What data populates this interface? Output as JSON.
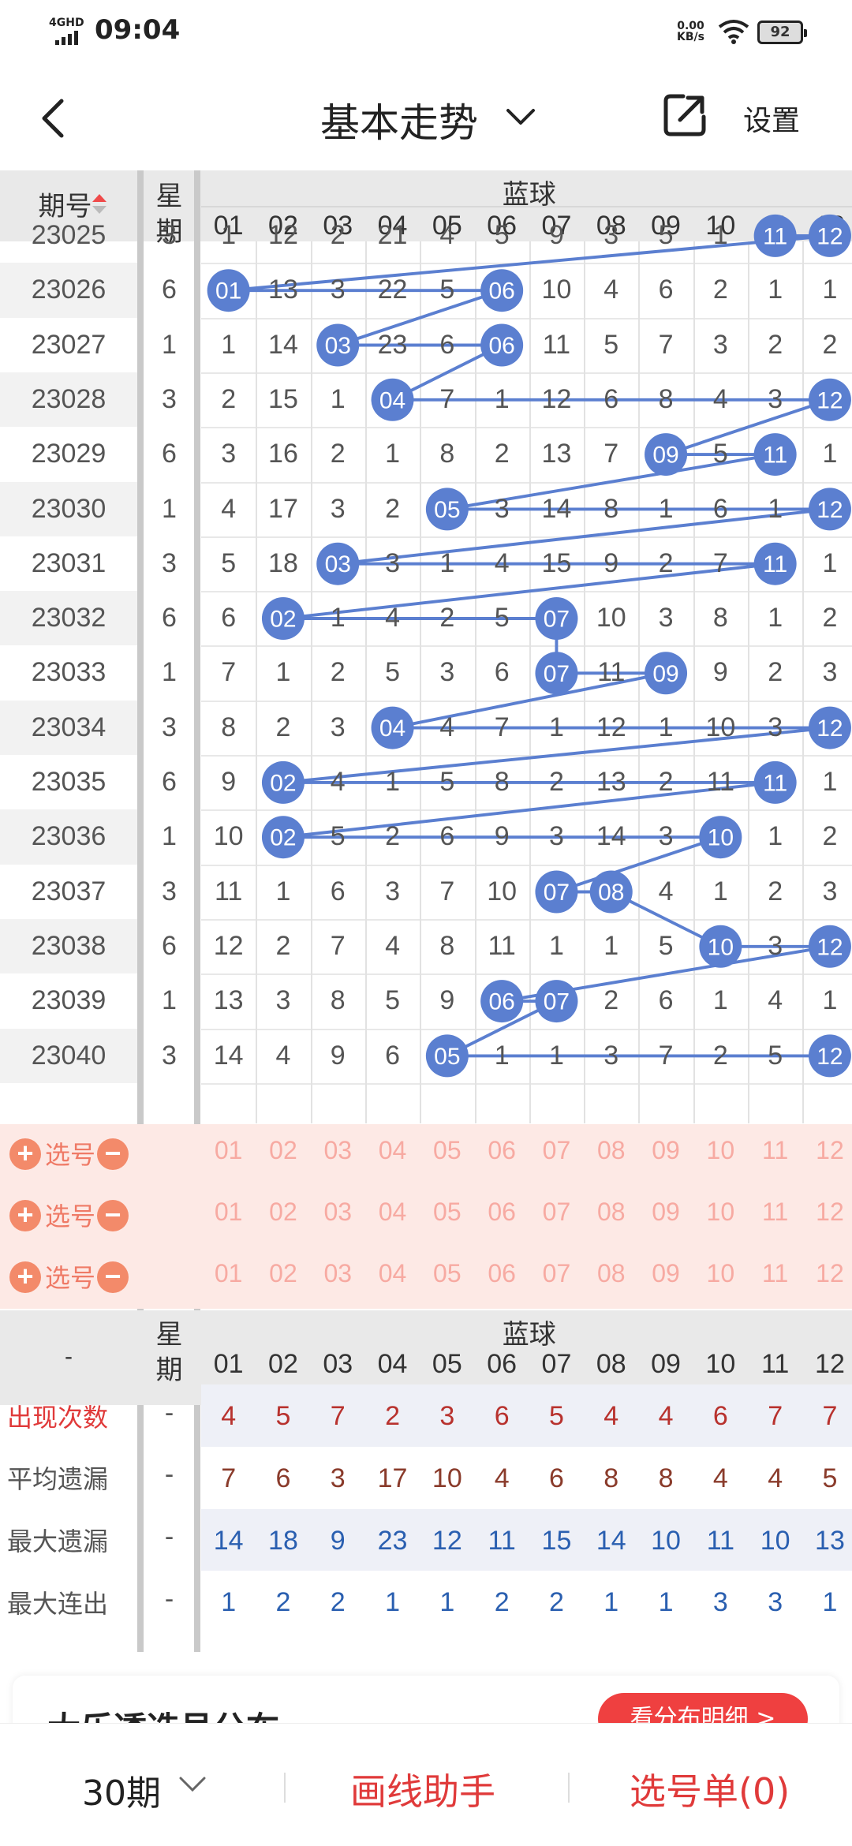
{
  "status_bar": {
    "network": "4GHD",
    "time": "09:04",
    "speed_value": "0.00",
    "speed_unit": "KB/s",
    "battery": "92"
  },
  "header": {
    "title": "基本走势",
    "settings": "设置"
  },
  "table": {
    "period_header": "期号",
    "week_header_1": "星",
    "week_header_2": "期",
    "section_header": "蓝球",
    "columns": [
      "01",
      "02",
      "03",
      "04",
      "05",
      "06",
      "07",
      "08",
      "09",
      "10",
      "11",
      "12"
    ],
    "rows": [
      {
        "period": "23025",
        "week": "3",
        "cells": [
          "1",
          "12",
          "2",
          "21",
          "4",
          "5",
          "9",
          "3",
          "5",
          "1",
          "11",
          "12"
        ]
      },
      {
        "period": "23026",
        "week": "6",
        "cells": [
          "01",
          "13",
          "3",
          "22",
          "5",
          "06",
          "10",
          "4",
          "6",
          "2",
          "1",
          "1"
        ]
      },
      {
        "period": "23027",
        "week": "1",
        "cells": [
          "1",
          "14",
          "03",
          "23",
          "6",
          "06",
          "11",
          "5",
          "7",
          "3",
          "2",
          "2"
        ]
      },
      {
        "period": "23028",
        "week": "3",
        "cells": [
          "2",
          "15",
          "1",
          "04",
          "7",
          "1",
          "12",
          "6",
          "8",
          "4",
          "3",
          "12"
        ]
      },
      {
        "period": "23029",
        "week": "6",
        "cells": [
          "3",
          "16",
          "2",
          "1",
          "8",
          "2",
          "13",
          "7",
          "09",
          "5",
          "11",
          "1"
        ]
      },
      {
        "period": "23030",
        "week": "1",
        "cells": [
          "4",
          "17",
          "3",
          "2",
          "05",
          "3",
          "14",
          "8",
          "1",
          "6",
          "1",
          "12"
        ]
      },
      {
        "period": "23031",
        "week": "3",
        "cells": [
          "5",
          "18",
          "03",
          "3",
          "1",
          "4",
          "15",
          "9",
          "2",
          "7",
          "11",
          "1"
        ]
      },
      {
        "period": "23032",
        "week": "6",
        "cells": [
          "6",
          "02",
          "1",
          "4",
          "2",
          "5",
          "07",
          "10",
          "3",
          "8",
          "1",
          "2"
        ]
      },
      {
        "period": "23033",
        "week": "1",
        "cells": [
          "7",
          "1",
          "2",
          "5",
          "3",
          "6",
          "07",
          "11",
          "09",
          "9",
          "2",
          "3"
        ]
      },
      {
        "period": "23034",
        "week": "3",
        "cells": [
          "8",
          "2",
          "3",
          "04",
          "4",
          "7",
          "1",
          "12",
          "1",
          "10",
          "3",
          "12"
        ]
      },
      {
        "period": "23035",
        "week": "6",
        "cells": [
          "9",
          "02",
          "4",
          "1",
          "5",
          "8",
          "2",
          "13",
          "2",
          "11",
          "11",
          "1"
        ]
      },
      {
        "period": "23036",
        "week": "1",
        "cells": [
          "10",
          "02",
          "5",
          "2",
          "6",
          "9",
          "3",
          "14",
          "3",
          "10",
          "1",
          "2"
        ]
      },
      {
        "period": "23037",
        "week": "3",
        "cells": [
          "11",
          "1",
          "6",
          "3",
          "7",
          "10",
          "07",
          "08",
          "4",
          "1",
          "2",
          "3"
        ]
      },
      {
        "period": "23038",
        "week": "6",
        "cells": [
          "12",
          "2",
          "7",
          "4",
          "8",
          "11",
          "1",
          "1",
          "5",
          "10",
          "3",
          "12"
        ]
      },
      {
        "period": "23039",
        "week": "1",
        "cells": [
          "13",
          "3",
          "8",
          "5",
          "9",
          "06",
          "07",
          "2",
          "6",
          "1",
          "4",
          "1"
        ]
      },
      {
        "period": "23040",
        "week": "3",
        "cells": [
          "14",
          "4",
          "9",
          "6",
          "05",
          "1",
          "1",
          "3",
          "7",
          "2",
          "5",
          "12"
        ]
      }
    ],
    "hits": [
      [
        10,
        11
      ],
      [
        0,
        5
      ],
      [
        2,
        5
      ],
      [
        3,
        11
      ],
      [
        8,
        10
      ],
      [
        4,
        11
      ],
      [
        2,
        10
      ],
      [
        1,
        6
      ],
      [
        6,
        8
      ],
      [
        3,
        11
      ],
      [
        1,
        10
      ],
      [
        1,
        9
      ],
      [
        6,
        7
      ],
      [
        9,
        11
      ],
      [
        5,
        6
      ],
      [
        4,
        11
      ]
    ],
    "select_label": "选号",
    "stats_corner": "-",
    "stats": [
      {
        "label": "出现次数",
        "dash": "-",
        "values": [
          "4",
          "5",
          "7",
          "2",
          "3",
          "6",
          "5",
          "4",
          "4",
          "6",
          "7",
          "7"
        ]
      },
      {
        "label": "平均遗漏",
        "dash": "-",
        "values": [
          "7",
          "6",
          "3",
          "17",
          "10",
          "4",
          "6",
          "8",
          "8",
          "4",
          "4",
          "5"
        ]
      },
      {
        "label": "最大遗漏",
        "dash": "-",
        "values": [
          "14",
          "18",
          "9",
          "23",
          "12",
          "11",
          "15",
          "14",
          "10",
          "11",
          "10",
          "13"
        ]
      },
      {
        "label": "最大连出",
        "dash": "-",
        "values": [
          "1",
          "2",
          "2",
          "1",
          "1",
          "2",
          "2",
          "1",
          "1",
          "3",
          "3",
          "1"
        ]
      }
    ]
  },
  "card": {
    "title": "大乐透选号分布",
    "button": "看分布明细 >"
  },
  "bottom": {
    "period": "30期",
    "helper": "画线助手",
    "list": "选号单(0)"
  },
  "colors": {
    "ball": "#5b7fd0",
    "line": "#5b7fd0",
    "accent": "#e03a3a",
    "selection_bg": "#fde9e5",
    "stat_red": "#b8322e",
    "stat_brown": "#8a3b2b",
    "stat_blue": "#2a5fb0"
  }
}
